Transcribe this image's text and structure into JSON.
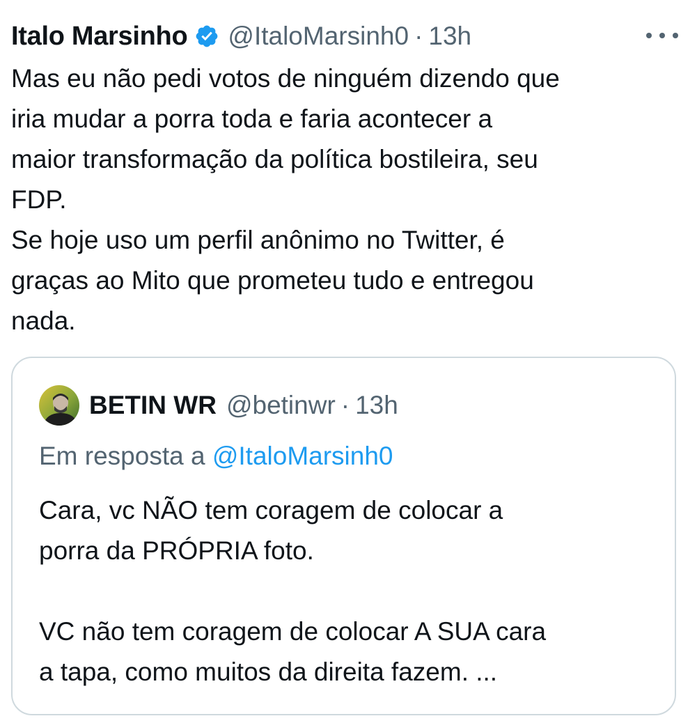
{
  "tweet": {
    "author_name": "Italo Marsinho",
    "handle": "@ItaloMarsinh0",
    "separator": "·",
    "time": "13h",
    "verified_icon": "verified-badge-icon",
    "more_icon": "more-options-icon",
    "lines": [
      "Mas eu não pedi votos de ninguém dizendo que",
      "iria mudar a porra toda e faria acontecer a",
      "maior transformação da política bostileira, seu",
      "FDP.",
      "Se hoje uso um perfil anônimo no Twitter, é",
      "graças ao Mito que prometeu tudo e entregou",
      "nada."
    ]
  },
  "quote": {
    "author_name": "BETIN WR",
    "handle": "@betinwr",
    "separator": "·",
    "time": "13h",
    "reply_prefix": "Em resposta a",
    "reply_to": "@ItaloMarsinh0",
    "paragraph1": [
      "Cara, vc NÃO tem coragem de colocar a",
      "porra da PRÓPRIA foto."
    ],
    "paragraph2": [
      "VC não tem coragem de colocar A SUA cara",
      "a tapa, como muitos da direita fazem. ..."
    ]
  },
  "colors": {
    "text": "#0f1419",
    "secondary": "#536471",
    "accent": "#1d9bf0",
    "border": "#cfd9de"
  }
}
